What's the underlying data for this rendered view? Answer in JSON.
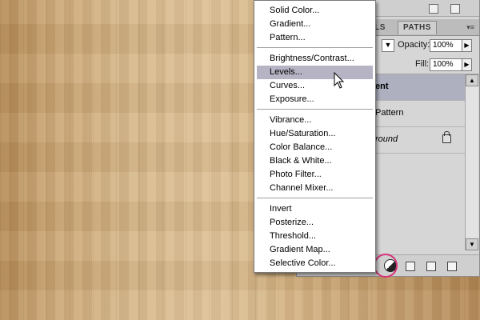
{
  "panel": {
    "tabs": {
      "channels_partial": "ELS",
      "paths": "PATHS"
    },
    "opacity_label": "Opacity:",
    "opacity_value": "100%",
    "fill_label": "Fill:",
    "fill_value": "100%",
    "layers": [
      {
        "name": "ent",
        "selected": true,
        "bold": true
      },
      {
        "name": "Pattern",
        "selected": false
      },
      {
        "name": "round",
        "selected": false,
        "italic": true,
        "locked": true
      }
    ]
  },
  "menu": {
    "items": [
      "Solid Color...",
      "Gradient...",
      "Pattern...",
      "Brightness/Contrast...",
      "Levels...",
      "Curves...",
      "Exposure...",
      "Vibrance...",
      "Hue/Saturation...",
      "Color Balance...",
      "Black & White...",
      "Photo Filter...",
      "Channel Mixer...",
      "Invert",
      "Posterize...",
      "Threshold...",
      "Gradient Map...",
      "Selective Color..."
    ],
    "highlighted": "Levels..."
  },
  "colors": {
    "menu_highlight": "#b5b3c4",
    "selected_layer": "#aeb0bf",
    "annotation_circle": "#d6337a"
  },
  "icons": [
    "adjustment-layer-icon",
    "lock-icon",
    "new-group-icon",
    "new-layer-icon",
    "trash-icon",
    "arrow-cursor-icon"
  ]
}
